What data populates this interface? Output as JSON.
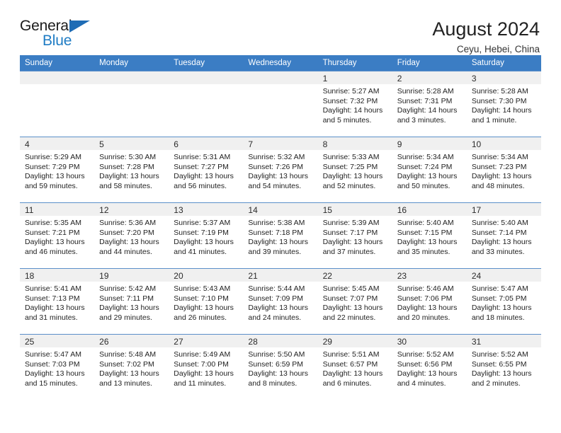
{
  "brand": {
    "name_top": "General",
    "name_bottom": "Blue"
  },
  "header": {
    "title": "August 2024",
    "subtitle": "Ceyu, Hebei, China"
  },
  "weekday_headers": [
    "Sunday",
    "Monday",
    "Tuesday",
    "Wednesday",
    "Thursday",
    "Friday",
    "Saturday"
  ],
  "colors": {
    "header_blue": "#3b7dc4",
    "row_rule": "#5b8fc9",
    "daynum_band": "#f0f0f0",
    "logo_blue": "#1f7cc4"
  },
  "labels": {
    "sunrise_prefix": "Sunrise: ",
    "sunset_prefix": "Sunset: ",
    "daylight_prefix": "Daylight: "
  },
  "weeks": [
    [
      {
        "num": "",
        "sunrise": "",
        "sunset": "",
        "daylight": "",
        "empty": true
      },
      {
        "num": "",
        "sunrise": "",
        "sunset": "",
        "daylight": "",
        "empty": true
      },
      {
        "num": "",
        "sunrise": "",
        "sunset": "",
        "daylight": "",
        "empty": true
      },
      {
        "num": "",
        "sunrise": "",
        "sunset": "",
        "daylight": "",
        "empty": true
      },
      {
        "num": "1",
        "sunrise": "Sunrise: 5:27 AM",
        "sunset": "Sunset: 7:32 PM",
        "daylight": "Daylight: 14 hours and 5 minutes."
      },
      {
        "num": "2",
        "sunrise": "Sunrise: 5:28 AM",
        "sunset": "Sunset: 7:31 PM",
        "daylight": "Daylight: 14 hours and 3 minutes."
      },
      {
        "num": "3",
        "sunrise": "Sunrise: 5:28 AM",
        "sunset": "Sunset: 7:30 PM",
        "daylight": "Daylight: 14 hours and 1 minute."
      }
    ],
    [
      {
        "num": "4",
        "sunrise": "Sunrise: 5:29 AM",
        "sunset": "Sunset: 7:29 PM",
        "daylight": "Daylight: 13 hours and 59 minutes."
      },
      {
        "num": "5",
        "sunrise": "Sunrise: 5:30 AM",
        "sunset": "Sunset: 7:28 PM",
        "daylight": "Daylight: 13 hours and 58 minutes."
      },
      {
        "num": "6",
        "sunrise": "Sunrise: 5:31 AM",
        "sunset": "Sunset: 7:27 PM",
        "daylight": "Daylight: 13 hours and 56 minutes."
      },
      {
        "num": "7",
        "sunrise": "Sunrise: 5:32 AM",
        "sunset": "Sunset: 7:26 PM",
        "daylight": "Daylight: 13 hours and 54 minutes."
      },
      {
        "num": "8",
        "sunrise": "Sunrise: 5:33 AM",
        "sunset": "Sunset: 7:25 PM",
        "daylight": "Daylight: 13 hours and 52 minutes."
      },
      {
        "num": "9",
        "sunrise": "Sunrise: 5:34 AM",
        "sunset": "Sunset: 7:24 PM",
        "daylight": "Daylight: 13 hours and 50 minutes."
      },
      {
        "num": "10",
        "sunrise": "Sunrise: 5:34 AM",
        "sunset": "Sunset: 7:23 PM",
        "daylight": "Daylight: 13 hours and 48 minutes."
      }
    ],
    [
      {
        "num": "11",
        "sunrise": "Sunrise: 5:35 AM",
        "sunset": "Sunset: 7:21 PM",
        "daylight": "Daylight: 13 hours and 46 minutes."
      },
      {
        "num": "12",
        "sunrise": "Sunrise: 5:36 AM",
        "sunset": "Sunset: 7:20 PM",
        "daylight": "Daylight: 13 hours and 44 minutes."
      },
      {
        "num": "13",
        "sunrise": "Sunrise: 5:37 AM",
        "sunset": "Sunset: 7:19 PM",
        "daylight": "Daylight: 13 hours and 41 minutes."
      },
      {
        "num": "14",
        "sunrise": "Sunrise: 5:38 AM",
        "sunset": "Sunset: 7:18 PM",
        "daylight": "Daylight: 13 hours and 39 minutes."
      },
      {
        "num": "15",
        "sunrise": "Sunrise: 5:39 AM",
        "sunset": "Sunset: 7:17 PM",
        "daylight": "Daylight: 13 hours and 37 minutes."
      },
      {
        "num": "16",
        "sunrise": "Sunrise: 5:40 AM",
        "sunset": "Sunset: 7:15 PM",
        "daylight": "Daylight: 13 hours and 35 minutes."
      },
      {
        "num": "17",
        "sunrise": "Sunrise: 5:40 AM",
        "sunset": "Sunset: 7:14 PM",
        "daylight": "Daylight: 13 hours and 33 minutes."
      }
    ],
    [
      {
        "num": "18",
        "sunrise": "Sunrise: 5:41 AM",
        "sunset": "Sunset: 7:13 PM",
        "daylight": "Daylight: 13 hours and 31 minutes."
      },
      {
        "num": "19",
        "sunrise": "Sunrise: 5:42 AM",
        "sunset": "Sunset: 7:11 PM",
        "daylight": "Daylight: 13 hours and 29 minutes."
      },
      {
        "num": "20",
        "sunrise": "Sunrise: 5:43 AM",
        "sunset": "Sunset: 7:10 PM",
        "daylight": "Daylight: 13 hours and 26 minutes."
      },
      {
        "num": "21",
        "sunrise": "Sunrise: 5:44 AM",
        "sunset": "Sunset: 7:09 PM",
        "daylight": "Daylight: 13 hours and 24 minutes."
      },
      {
        "num": "22",
        "sunrise": "Sunrise: 5:45 AM",
        "sunset": "Sunset: 7:07 PM",
        "daylight": "Daylight: 13 hours and 22 minutes."
      },
      {
        "num": "23",
        "sunrise": "Sunrise: 5:46 AM",
        "sunset": "Sunset: 7:06 PM",
        "daylight": "Daylight: 13 hours and 20 minutes."
      },
      {
        "num": "24",
        "sunrise": "Sunrise: 5:47 AM",
        "sunset": "Sunset: 7:05 PM",
        "daylight": "Daylight: 13 hours and 18 minutes."
      }
    ],
    [
      {
        "num": "25",
        "sunrise": "Sunrise: 5:47 AM",
        "sunset": "Sunset: 7:03 PM",
        "daylight": "Daylight: 13 hours and 15 minutes."
      },
      {
        "num": "26",
        "sunrise": "Sunrise: 5:48 AM",
        "sunset": "Sunset: 7:02 PM",
        "daylight": "Daylight: 13 hours and 13 minutes."
      },
      {
        "num": "27",
        "sunrise": "Sunrise: 5:49 AM",
        "sunset": "Sunset: 7:00 PM",
        "daylight": "Daylight: 13 hours and 11 minutes."
      },
      {
        "num": "28",
        "sunrise": "Sunrise: 5:50 AM",
        "sunset": "Sunset: 6:59 PM",
        "daylight": "Daylight: 13 hours and 8 minutes."
      },
      {
        "num": "29",
        "sunrise": "Sunrise: 5:51 AM",
        "sunset": "Sunset: 6:57 PM",
        "daylight": "Daylight: 13 hours and 6 minutes."
      },
      {
        "num": "30",
        "sunrise": "Sunrise: 5:52 AM",
        "sunset": "Sunset: 6:56 PM",
        "daylight": "Daylight: 13 hours and 4 minutes."
      },
      {
        "num": "31",
        "sunrise": "Sunrise: 5:52 AM",
        "sunset": "Sunset: 6:55 PM",
        "daylight": "Daylight: 13 hours and 2 minutes."
      }
    ]
  ]
}
